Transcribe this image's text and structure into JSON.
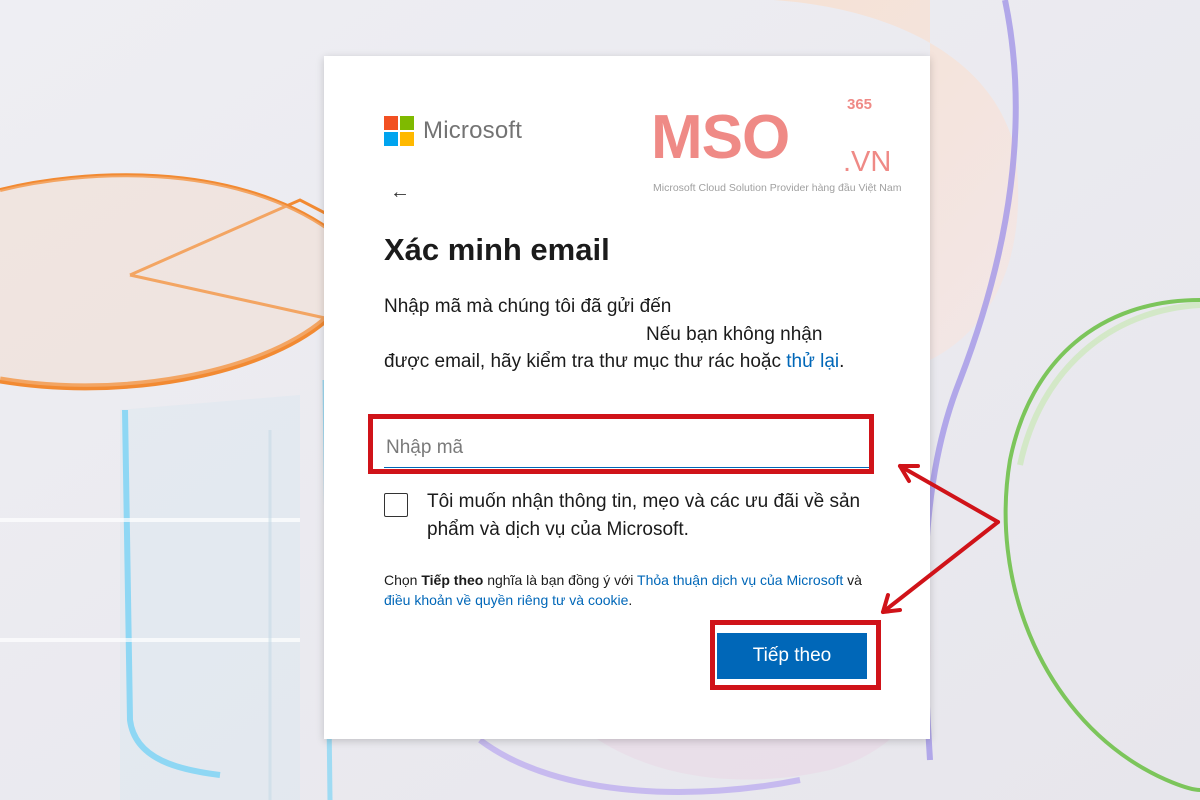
{
  "logo": {
    "brand": "Microsoft",
    "colors": [
      "#f25022",
      "#7fba00",
      "#00a4ef",
      "#ffb900"
    ]
  },
  "watermark": {
    "name": "MSO",
    "superscript": "365",
    "suffix": ".VN",
    "tagline": "Microsoft Cloud Solution Provider hàng đầu Việt Nam"
  },
  "page": {
    "back_icon": "arrow-left-icon",
    "back_glyph": "←",
    "title": "Xác minh email",
    "description_line1": "Nhập mã mà chúng tôi đã gửi đến",
    "description_line2": "Nếu bạn không nhận",
    "description_line3": "được email, hãy kiểm tra thư mục thư rác hoặc",
    "retry_link": "thử lại",
    "period": "."
  },
  "code_input": {
    "placeholder": "Nhập mã",
    "value": ""
  },
  "marketing_checkbox": {
    "label": "Tôi muốn nhận thông tin, mẹo và các ưu đãi về sản phẩm và dịch vụ của Microsoft.",
    "checked": false
  },
  "terms": {
    "prefix": "Chọn",
    "action": "Tiếp theo",
    "middle": "nghĩa là bạn đồng ý với",
    "service_link": "Thỏa thuận dịch vụ của Microsoft",
    "and": "và",
    "privacy_link": "điều khoản về quyền riêng tư và cookie",
    "end": "."
  },
  "next_button": {
    "label": "Tiếp theo"
  },
  "colors": {
    "accent": "#0067b8",
    "highlight": "#d01319",
    "watermark": "#ef8a86"
  }
}
